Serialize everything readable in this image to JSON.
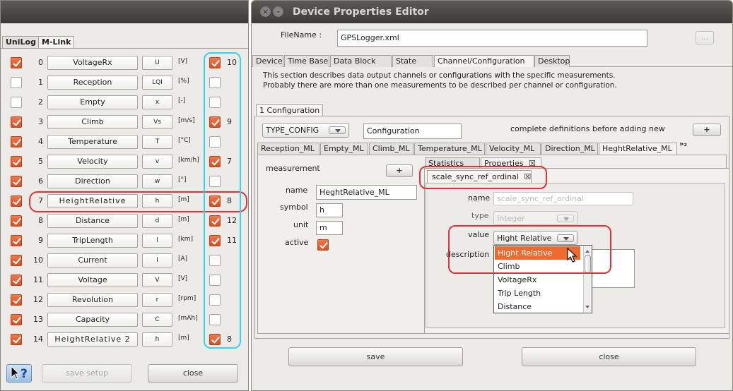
{
  "left_window": {
    "tabs": [
      "UniLog",
      "M-Link"
    ],
    "rows": [
      {
        "active": true,
        "num": "0",
        "name": "VoltageRx",
        "symbol": "U",
        "unit": "[V]",
        "sync": true,
        "sync_num": "10"
      },
      {
        "active": false,
        "num": "1",
        "name": "Reception",
        "symbol": "LQI",
        "unit": "[%]",
        "sync": false,
        "sync_num": ""
      },
      {
        "active": false,
        "num": "2",
        "name": "Empty",
        "symbol": "x",
        "unit": "[-]",
        "sync": false,
        "sync_num": ""
      },
      {
        "active": true,
        "num": "3",
        "name": "Climb",
        "symbol": "Vs",
        "unit": "[m/s]",
        "sync": true,
        "sync_num": "9"
      },
      {
        "active": true,
        "num": "4",
        "name": "Temperature",
        "symbol": "T",
        "unit": "[°C]",
        "sync": false,
        "sync_num": ""
      },
      {
        "active": true,
        "num": "5",
        "name": "Velocity",
        "symbol": "v",
        "unit": "[km/h]",
        "sync": true,
        "sync_num": "7"
      },
      {
        "active": true,
        "num": "6",
        "name": "Direction",
        "symbol": "w",
        "unit": "[°]",
        "sync": false,
        "sync_num": ""
      },
      {
        "active": true,
        "num": "7",
        "name": "HeightRelative",
        "symbol": "h",
        "unit": "[m]",
        "sync": true,
        "sync_num": "8"
      },
      {
        "active": true,
        "num": "8",
        "name": "Distance",
        "symbol": "d",
        "unit": "[m]",
        "sync": true,
        "sync_num": "12"
      },
      {
        "active": true,
        "num": "9",
        "name": "TripLength",
        "symbol": "l",
        "unit": "[km]",
        "sync": true,
        "sync_num": "11"
      },
      {
        "active": true,
        "num": "10",
        "name": "Current",
        "symbol": "I",
        "unit": "[A]",
        "sync": false,
        "sync_num": ""
      },
      {
        "active": true,
        "num": "11",
        "name": "Voltage",
        "symbol": "V",
        "unit": "[V]",
        "sync": false,
        "sync_num": ""
      },
      {
        "active": true,
        "num": "12",
        "name": "Revolution",
        "symbol": "r",
        "unit": "[rpm]",
        "sync": false,
        "sync_num": ""
      },
      {
        "active": true,
        "num": "13",
        "name": "Capacity",
        "symbol": "C",
        "unit": "[mAh]",
        "sync": false,
        "sync_num": ""
      },
      {
        "active": true,
        "num": "14",
        "name": "HeightRelative 2",
        "symbol": "h",
        "unit": "[m]",
        "sync": true,
        "sync_num": "8"
      }
    ],
    "help_icon": "help-cursor-icon",
    "save_setup": "save setup",
    "close": "close"
  },
  "editor": {
    "title": "Device Properties Editor",
    "filename_label": "FileName :",
    "filename_value": "GPSLogger.xml",
    "browse_label": "...",
    "main_tabs": [
      "Device",
      "Time Base",
      "Data Block",
      "State",
      "Channel/Configuration",
      "Desktop"
    ],
    "description": [
      "This section describes data output channels or configurations with the specific measurements.",
      "Probably there are more than one measurements to be described per channel or configuration."
    ],
    "config_tab": "1 Configuration",
    "config_type": "TYPE_CONFIG",
    "config_name": "Configuration",
    "complete_note": "complete definitions before adding new",
    "add_label": "+",
    "measurement_tabs": [
      "Reception_ML",
      "Empty_ML",
      "Climb_ML",
      "Temperature_ML",
      "Velocity_ML",
      "Direction_ML",
      "HeghtRelative_ML"
    ],
    "more_tabs": "»₂",
    "measurement_label": "measurement",
    "fields": {
      "name_label": "name",
      "name_value": "HeghtRelative_ML",
      "symbol_label": "symbol",
      "symbol_value": "h",
      "unit_label": "unit",
      "unit_value": "m",
      "active_label": "active"
    },
    "sub_tabs": [
      "Statistics",
      "Properties"
    ],
    "property_tab": "scale_sync_ref_ordinal",
    "prop": {
      "name_label": "name",
      "name_value": "scale_sync_ref_ordinal",
      "type_label": "type",
      "type_value": "Integer",
      "value_label": "value",
      "value_value": "Hight Relative",
      "description_label": "description"
    },
    "dropdown": [
      "Hight Relative",
      "Climb",
      "VoltageRx",
      "Trip Length",
      "Distance"
    ],
    "save": "save",
    "close": "close"
  }
}
